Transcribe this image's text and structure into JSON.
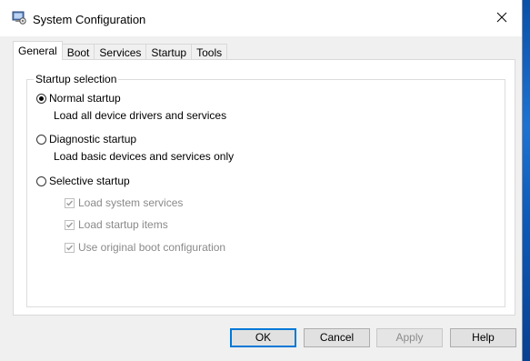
{
  "window": {
    "title": "System Configuration",
    "app_icon": "msconfig-icon",
    "close_icon": "close-icon"
  },
  "tabs": [
    {
      "label": "General",
      "active": true
    },
    {
      "label": "Boot",
      "active": false
    },
    {
      "label": "Services",
      "active": false
    },
    {
      "label": "Startup",
      "active": false
    },
    {
      "label": "Tools",
      "active": false
    }
  ],
  "startup_selection": {
    "group_label": "Startup selection",
    "normal": {
      "label": "Normal startup",
      "description": "Load all device drivers and services",
      "checked": true
    },
    "diagnostic": {
      "label": "Diagnostic startup",
      "description": "Load basic devices and services only",
      "checked": false
    },
    "selective": {
      "label": "Selective startup",
      "checked": false,
      "options": [
        {
          "label": "Load system services",
          "checked": true,
          "enabled": false
        },
        {
          "label": "Load startup items",
          "checked": true,
          "enabled": false
        },
        {
          "label": "Use original boot configuration",
          "checked": true,
          "enabled": false
        }
      ]
    }
  },
  "buttons": {
    "ok": "OK",
    "cancel": "Cancel",
    "apply": "Apply",
    "help": "Help"
  }
}
